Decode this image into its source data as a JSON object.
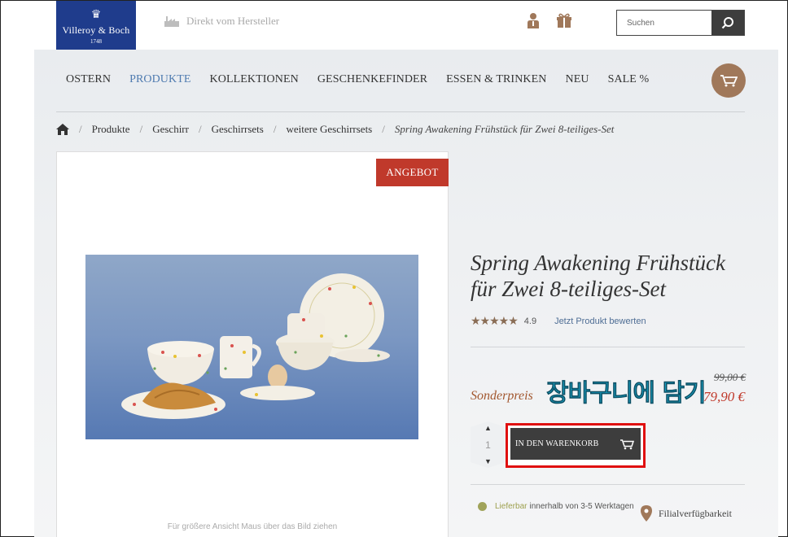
{
  "header": {
    "brand": "Villeroy & Boch",
    "brand_year": "1748",
    "factory_text": "Direkt vom Hersteller",
    "search_placeholder": "Suchen"
  },
  "nav": {
    "items": [
      "OSTERN",
      "PRODUKTE",
      "KOLLEKTIONEN",
      "GESCHENKEFINDER",
      "ESSEN & TRINKEN",
      "NEU",
      "SALE %"
    ],
    "active": "PRODUKTE"
  },
  "breadcrumb": {
    "items": [
      "Produkte",
      "Geschirr",
      "Geschirrsets",
      "weitere Geschirrsets"
    ],
    "current": "Spring Awakening Frühstück für Zwei 8-teiliges-Set"
  },
  "product": {
    "badge": "ANGEBOT",
    "zoom_hint": "Für größere Ansicht Maus über das Bild ziehen",
    "title": "Spring Awakening Frühstück für Zwei 8-teiliges-Set",
    "stars": "★★★★★",
    "rating": "4.9",
    "rate_link": "Jetzt Produkt bewerten",
    "price_label": "Sonderpreis",
    "old_price": "99,00 €",
    "new_price": "79,90 €",
    "annotation": "장바구니에 담기",
    "quantity": "1",
    "add_to_cart": "IN DEN WARENKORB",
    "availability_status": "Lieferbar",
    "availability_text": "innerhalb von 3-5 Werktagen",
    "store_link": "Filialverfügbarkeit"
  },
  "colors": {
    "brand_blue": "#1f3c8c",
    "accent_brown": "#a0785a",
    "sale_red": "#c0392b",
    "nav_active": "#4f7bb0",
    "highlight_box": "#e01010"
  }
}
